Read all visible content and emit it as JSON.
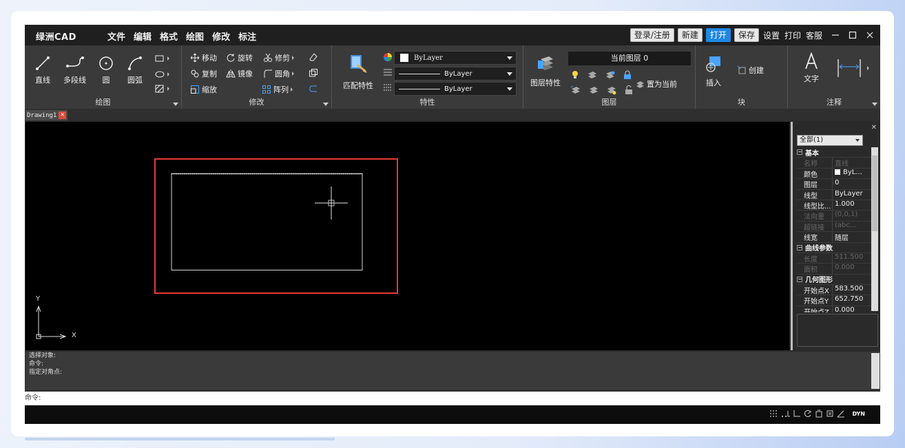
{
  "app": {
    "title": "绿洲CAD"
  },
  "menu": [
    "文件",
    "编辑",
    "格式",
    "绘图",
    "修改",
    "标注"
  ],
  "titlebar_buttons": {
    "login": "登录/注册",
    "new": "新建",
    "open": "打开",
    "save": "保存",
    "settings": "设置",
    "print": "打印",
    "service": "客服"
  },
  "ribbon": {
    "draw": {
      "title": "绘图",
      "tools": [
        "直线",
        "多段线",
        "圆",
        "圆弧"
      ]
    },
    "modify": {
      "title": "修改",
      "tools": [
        "移动",
        "旋转",
        "修剪",
        "复制",
        "镜像",
        "圆角",
        "缩放",
        "阵列"
      ]
    },
    "properties": {
      "title": "特性",
      "match_label": "匹配特性",
      "color": "ByLayer",
      "linetype": "ByLayer",
      "lineweight": "ByLayer"
    },
    "layers": {
      "title": "图层",
      "props_label": "图层特性",
      "current_layer": "当前图层 0",
      "set_current": "置为当前"
    },
    "block": {
      "title": "块",
      "insert": "插入",
      "create": "创建"
    },
    "annotation": {
      "title": "注释",
      "text": "文字"
    }
  },
  "document_tab": "Drawing1",
  "axes": {
    "y": "Y",
    "x": "X"
  },
  "palette": {
    "selection": "全部(1)",
    "rows": [
      {
        "type": "section",
        "k": "基本"
      },
      {
        "type": "dim",
        "k": "名称",
        "v": "直线"
      },
      {
        "type": "row",
        "k": "颜色",
        "v": "ByL..."
      },
      {
        "type": "row",
        "k": "图层",
        "v": "0"
      },
      {
        "type": "row",
        "k": "线型",
        "v": "ByLayer"
      },
      {
        "type": "row",
        "k": "线型比...",
        "v": "1.000"
      },
      {
        "type": "dim",
        "k": "法向量",
        "v": "(0,0,1)"
      },
      {
        "type": "dim",
        "k": "超链接",
        "v": "(abc..."
      },
      {
        "type": "row",
        "k": "线宽",
        "v": "随层"
      },
      {
        "type": "section",
        "k": "曲线参数"
      },
      {
        "type": "dim",
        "k": "长度",
        "v": "511.500"
      },
      {
        "type": "dim",
        "k": "面积",
        "v": "0.000"
      },
      {
        "type": "section",
        "k": "几何图形"
      },
      {
        "type": "row",
        "k": "开始点X",
        "v": "583.500"
      },
      {
        "type": "row",
        "k": "开始点Y",
        "v": "652.750"
      },
      {
        "type": "row",
        "k": "开始点Z",
        "v": "0.000"
      }
    ]
  },
  "command": {
    "history": [
      "选择对象:",
      "命令:",
      "指定对角点:"
    ],
    "prompt": "命令:"
  },
  "status": {
    "dyn": "DYN"
  },
  "colors": {
    "highlight": "#e53935",
    "open_button": "#1e88e5"
  }
}
